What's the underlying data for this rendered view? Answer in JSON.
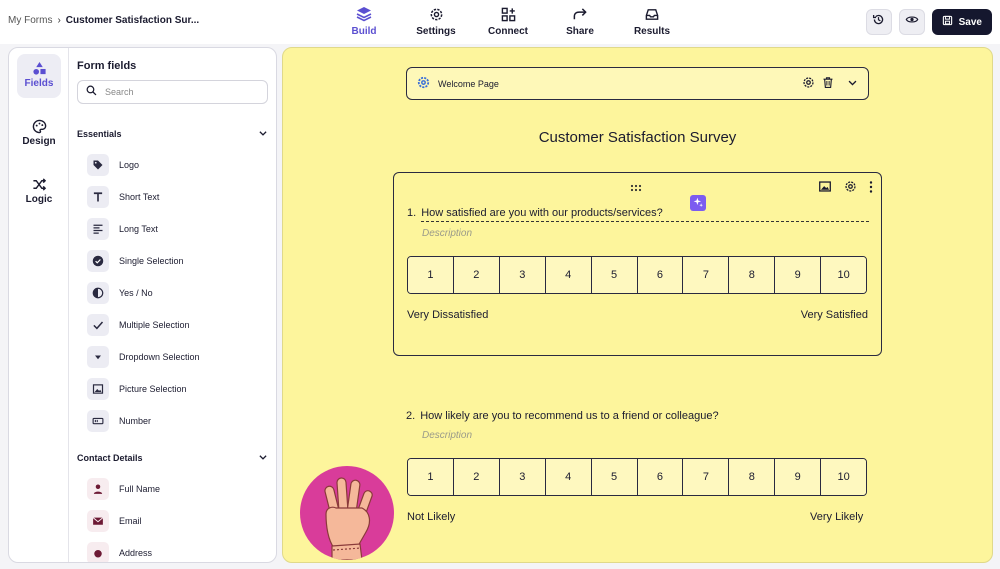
{
  "breadcrumb": {
    "root": "My Forms",
    "separator": "›",
    "current": "Customer Satisfaction Sur..."
  },
  "nav": {
    "tabs": [
      {
        "label": "Build",
        "icon": "layers-icon",
        "active": true
      },
      {
        "label": "Settings",
        "icon": "gear-icon",
        "active": false
      },
      {
        "label": "Connect",
        "icon": "integrations-icon",
        "active": false
      },
      {
        "label": "Share",
        "icon": "share-arrow-icon",
        "active": false
      },
      {
        "label": "Results",
        "icon": "inbox-icon",
        "active": false
      }
    ]
  },
  "header_actions": {
    "history_icon": "history-icon",
    "preview_icon": "eye-icon",
    "save_label": "Save"
  },
  "rail": {
    "items": [
      {
        "label": "Fields",
        "icon": "shapes-icon",
        "active": true
      },
      {
        "label": "Design",
        "icon": "palette-icon",
        "active": false
      },
      {
        "label": "Logic",
        "icon": "shuffle-icon",
        "active": false
      }
    ]
  },
  "fields_panel": {
    "title": "Form fields",
    "search_placeholder": "Search",
    "essentials": {
      "title": "Essentials",
      "items": [
        {
          "label": "Logo",
          "icon": "tag-icon"
        },
        {
          "label": "Short Text",
          "icon": "text-t-icon"
        },
        {
          "label": "Long Text",
          "icon": "paragraph-icon"
        },
        {
          "label": "Single Selection",
          "icon": "check-circle-icon"
        },
        {
          "label": "Yes / No",
          "icon": "yes-no-icon"
        },
        {
          "label": "Multiple Selection",
          "icon": "checkmark-icon"
        },
        {
          "label": "Dropdown Selection",
          "icon": "dropdown-icon"
        },
        {
          "label": "Picture Selection",
          "icon": "picture-icon"
        },
        {
          "label": "Number",
          "icon": "number-icon"
        }
      ]
    },
    "contact": {
      "title": "Contact Details",
      "items": [
        {
          "label": "Full Name",
          "icon": "person-icon"
        },
        {
          "label": "Email",
          "icon": "envelope-icon"
        },
        {
          "label": "Address",
          "icon": "location-icon"
        }
      ]
    }
  },
  "canvas": {
    "welcome_page": {
      "label": "Welcome Page"
    },
    "survey_title": "Customer Satisfaction Survey",
    "questions": [
      {
        "number": "1.",
        "text": "How satisfied are you with our products/services?",
        "description_placeholder": "Description",
        "scale": [
          "1",
          "2",
          "3",
          "4",
          "5",
          "6",
          "7",
          "8",
          "9",
          "10"
        ],
        "min_label": "Very Dissatisfied",
        "max_label": "Very Satisfied"
      },
      {
        "number": "2.",
        "text": "How likely are you to recommend us to a friend or colleague?",
        "description_placeholder": "Description",
        "scale": [
          "1",
          "2",
          "3",
          "4",
          "5",
          "6",
          "7",
          "8",
          "9",
          "10"
        ],
        "min_label": "Not Likely",
        "max_label": "Very Likely"
      }
    ]
  },
  "colors": {
    "accent": "#5b4fd1",
    "canvas_bg": "#fdf59c",
    "save_bg": "#15172e",
    "hand_circle": "#d93c9a"
  }
}
